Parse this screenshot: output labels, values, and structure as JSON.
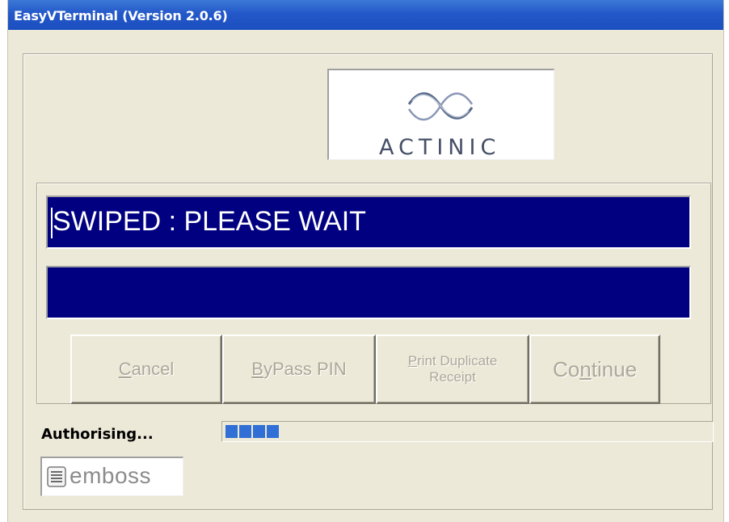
{
  "window": {
    "title": "EasyVTerminal (Version 2.0.6)"
  },
  "logo": {
    "brand": "ACTINIC",
    "icon": "actinic-wave-icon"
  },
  "display": {
    "line1": "SWIPED : PLEASE WAIT",
    "line2": ""
  },
  "buttons": {
    "cancel": {
      "mnemonic": "C",
      "rest": "ancel"
    },
    "bypass_pin": {
      "mnemonic": "B",
      "rest": "yPass PIN"
    },
    "print_duplicate": {
      "mnemonic": "P",
      "rest_line1": "rint Duplicate",
      "line2": "Receipt"
    },
    "continue": {
      "pre": "Co",
      "mnemonic": "n",
      "rest": "tinue"
    }
  },
  "status": {
    "label": "Authorising...",
    "progress_blocks": 4
  },
  "footer_logo": {
    "text": "emboss",
    "icon": "emboss-icon"
  },
  "colors": {
    "title_bar": "#2358c9",
    "display_bg": "#000080",
    "display_text": "#ffffff",
    "window_bg": "#ece9d8",
    "disabled_text": "#aca899",
    "progress": "#2f6fd6"
  }
}
